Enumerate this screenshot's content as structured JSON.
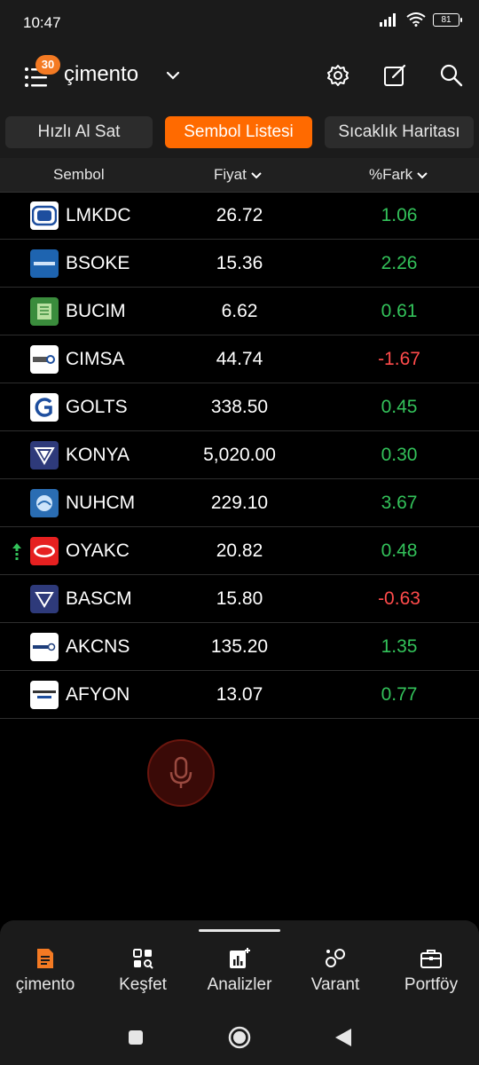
{
  "status_bar": {
    "time": "10:47",
    "battery": "81"
  },
  "header": {
    "badge_count": "30",
    "title": "çimento"
  },
  "tabs": [
    {
      "label": "Hızlı Al Sat",
      "active": false
    },
    {
      "label": "Sembol Listesi",
      "active": true
    },
    {
      "label": "Sıcaklık Haritası",
      "active": false
    }
  ],
  "table": {
    "headers": {
      "symbol": "Sembol",
      "price": "Fiyat",
      "change": "%Fark"
    },
    "rows": [
      {
        "symbol": "LMKDC",
        "price": "26.72",
        "change": "1.06",
        "direction": "up"
      },
      {
        "symbol": "BSOKE",
        "price": "15.36",
        "change": "2.26",
        "direction": "up"
      },
      {
        "symbol": "BUCIM",
        "price": "6.62",
        "change": "0.61",
        "direction": "up"
      },
      {
        "symbol": "CIMSA",
        "price": "44.74",
        "change": "-1.67",
        "direction": "down"
      },
      {
        "symbol": "GOLTS",
        "price": "338.50",
        "change": "0.45",
        "direction": "up"
      },
      {
        "symbol": "KONYA",
        "price": "5,020.00",
        "change": "0.30",
        "direction": "up"
      },
      {
        "symbol": "NUHCM",
        "price": "229.10",
        "change": "3.67",
        "direction": "up"
      },
      {
        "symbol": "OYAKC",
        "price": "20.82",
        "change": "0.48",
        "direction": "up",
        "arrow": "up"
      },
      {
        "symbol": "BASCM",
        "price": "15.80",
        "change": "-0.63",
        "direction": "down"
      },
      {
        "symbol": "AKCNS",
        "price": "135.20",
        "change": "1.35",
        "direction": "up"
      },
      {
        "symbol": "AFYON",
        "price": "13.07",
        "change": "0.77",
        "direction": "up"
      }
    ]
  },
  "bottom_nav": [
    {
      "label": "çimento",
      "icon": "document-list-icon",
      "active": true
    },
    {
      "label": "Keşfet",
      "icon": "discover-grid-icon",
      "active": false
    },
    {
      "label": "Analizler",
      "icon": "analysis-chart-icon",
      "active": false
    },
    {
      "label": "Varant",
      "icon": "warrant-circles-icon",
      "active": false
    },
    {
      "label": "Portföy",
      "icon": "briefcase-icon",
      "active": false
    }
  ],
  "colors": {
    "accent": "#ff6a00",
    "positive": "#33c25a",
    "negative": "#ff4b4b",
    "background": "#000000",
    "bar": "#1b1b1b"
  }
}
